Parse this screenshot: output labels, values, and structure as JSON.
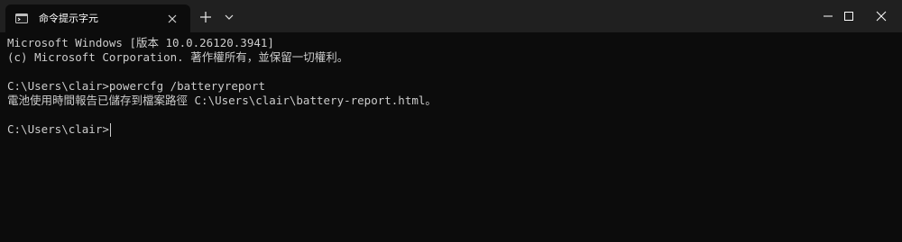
{
  "window": {
    "tab_title": "命令提示字元"
  },
  "icons": {
    "tab": "terminal-icon",
    "tab_close": "close-icon",
    "new_tab": "plus-icon",
    "dropdown": "chevron-down-icon",
    "minimize": "minimize-icon",
    "maximize": "maximize-icon",
    "close": "close-icon"
  },
  "colors": {
    "titlebar_bg": "#202020",
    "terminal_bg": "#0c0c0c",
    "text": "#cccccc"
  },
  "terminal": {
    "lines": [
      "Microsoft Windows [版本 10.0.26120.3941]",
      "(c) Microsoft Corporation. 著作權所有，並保留一切權利。",
      "",
      "C:\\Users\\clair>powercfg /batteryreport",
      "電池使用時間報告已儲存到檔案路徑 C:\\Users\\clair\\battery-report.html。",
      ""
    ],
    "prompt": "C:\\Users\\clair>"
  }
}
